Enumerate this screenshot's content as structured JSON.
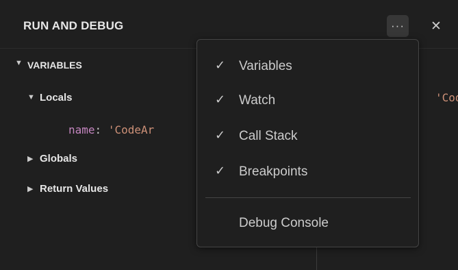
{
  "header": {
    "title": "RUN AND DEBUG",
    "more_icon": "···",
    "close_icon": "✕"
  },
  "variables_section": {
    "twistie": "▼",
    "label": "VARIABLES",
    "scopes": [
      {
        "twistie": "▼",
        "label": "Locals"
      },
      {
        "twistie": "▶",
        "label": "Globals"
      },
      {
        "twistie": "▶",
        "label": "Return Values"
      }
    ],
    "local_var": {
      "name": "name",
      "colon": ":",
      "value": "'CodeAr"
    },
    "right_peek": "'Code"
  },
  "context_menu": {
    "check_glyph": "✓",
    "items": [
      {
        "label": "Variables",
        "checked": true
      },
      {
        "label": "Watch",
        "checked": true
      },
      {
        "label": "Call Stack",
        "checked": true
      },
      {
        "label": "Breakpoints",
        "checked": true
      },
      {
        "label": "Debug Console",
        "checked": false
      }
    ]
  },
  "colors": {
    "background": "#1f1f1f",
    "variable_name": "#c586c0",
    "string_value": "#ce9178"
  }
}
